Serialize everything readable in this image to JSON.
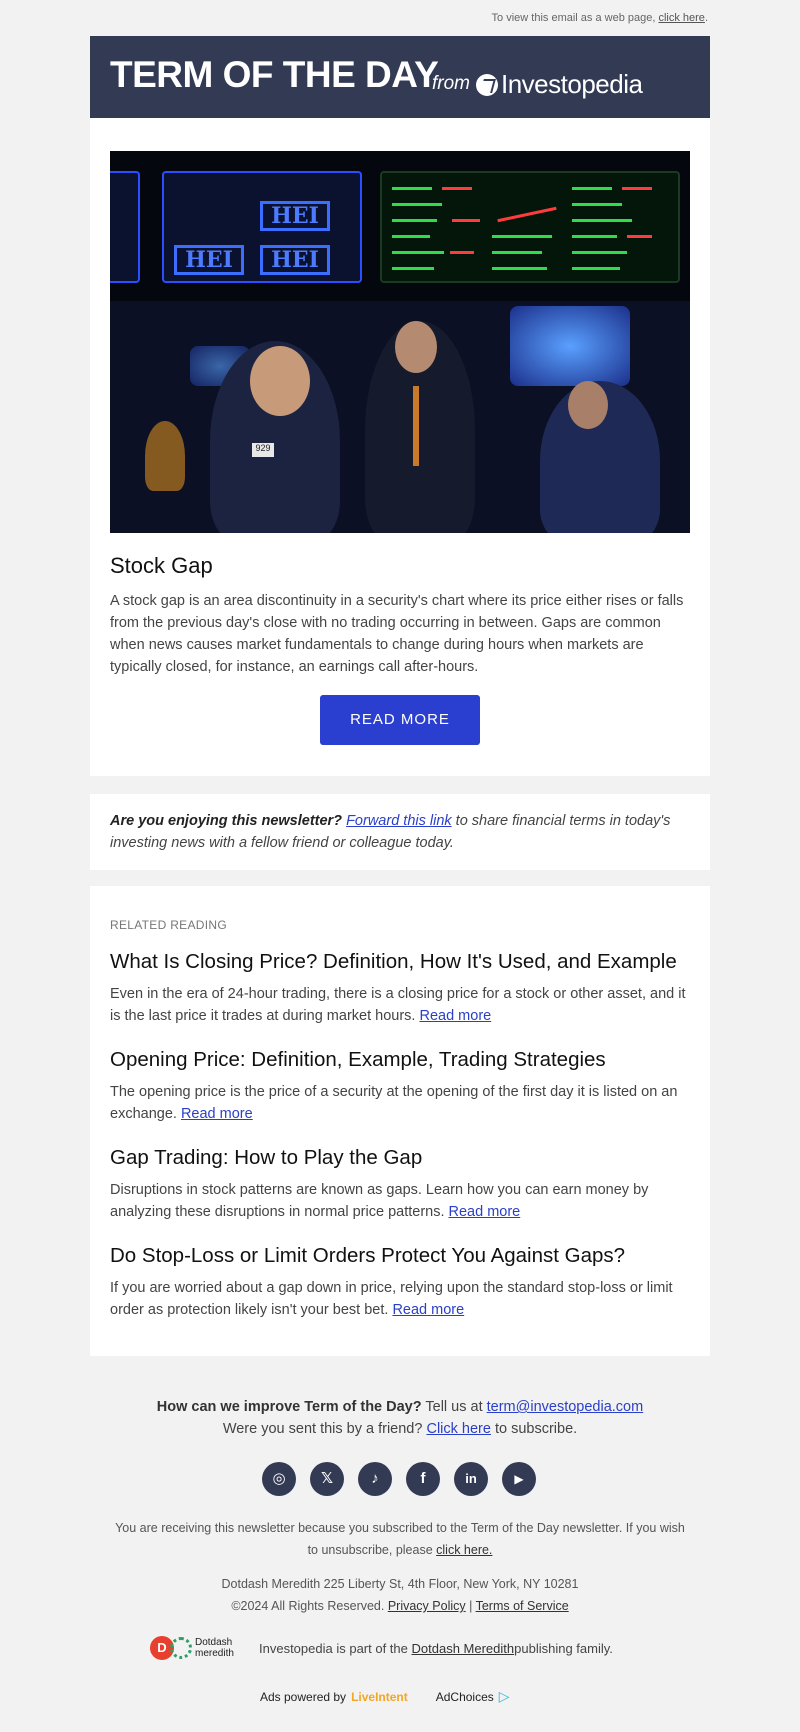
{
  "topline": {
    "text": "To view this email as a web page, ",
    "link": "click here",
    "end": "."
  },
  "header": {
    "title": "TERM OF THE DAY",
    "from": "from",
    "brand": "Investopedia"
  },
  "hero": {
    "board_labels": [
      "HEI",
      "HEI",
      "HEI"
    ],
    "badge": "929"
  },
  "term": {
    "title": "Stock Gap",
    "description": "A stock gap is an area discontinuity in a security's chart where its price either rises or falls from the previous day's close with no trading occurring in between. Gaps are common when news causes market fundamentals to change during hours when markets are typically closed, for instance, an earnings call after-hours.",
    "button": "READ MORE"
  },
  "share": {
    "bold": "Are you enjoying this newsletter?",
    "link": "Forward this link",
    "rest": " to share financial terms in today's investing news with a fellow friend or colleague today."
  },
  "related": {
    "label": "RELATED READING",
    "read_more": "Read more",
    "articles": [
      {
        "title": "What Is Closing Price? Definition, How It's Used, and Example",
        "summary": "Even in the era of 24-hour trading, there is a closing price for a stock or other asset, and it is the last price it trades at during market hours."
      },
      {
        "title": "Opening Price: Definition, Example, Trading Strategies",
        "summary": "The opening price is the price of a security at the opening of the first day it is listed on an exchange."
      },
      {
        "title": "Gap Trading: How to Play the Gap",
        "summary": "Disruptions in stock patterns are known as gaps. Learn how you can earn money by analyzing these disruptions in normal price patterns."
      },
      {
        "title": "Do Stop-Loss or Limit Orders Protect You Against Gaps?",
        "summary": "If you are worried about a gap down in price, relying upon the standard stop-loss or limit order as protection likely isn't your best bet."
      }
    ]
  },
  "footer": {
    "q": "How can we improve Term of the Day?",
    "tell": " Tell us at ",
    "email": "term@investopedia.com",
    "friend": "Were you sent this by a friend? ",
    "click": "Click here",
    "subscribe": " to subscribe.",
    "social": [
      {
        "icon": "instagram-icon",
        "glyph": "◎"
      },
      {
        "icon": "x-icon",
        "glyph": "𝕏"
      },
      {
        "icon": "tiktok-icon",
        "glyph": "♪"
      },
      {
        "icon": "facebook-icon",
        "glyph": "f"
      },
      {
        "icon": "linkedin-icon",
        "glyph": "in"
      },
      {
        "icon": "youtube-icon",
        "glyph": "▶"
      }
    ],
    "unsub_text": "You are receiving this newsletter because you subscribed to the Term of the Day newsletter. If you wish to unsubscribe, please ",
    "unsub_link": "click here.",
    "address": "Dotdash Meredith 225 Liberty St, 4th Floor, New York, NY 10281",
    "rights": "©2024 All Rights Reserved. ",
    "privacy": "Privacy Policy",
    "sep": " | ",
    "terms": "Terms of Service",
    "ddm_logo": "Dotdash meredith",
    "ddm_logo_d": "D",
    "family_text": "Investopedia is part of the ",
    "family_link": "Dotdash Meredith",
    "family_end": " publishing family.",
    "ads_text": "Ads powered by",
    "liveintent": "LiveIntent",
    "adchoices": "AdChoices"
  },
  "colors": {
    "header_bg": "#333a54",
    "button": "#2a3fcf",
    "link": "#2a3fc9",
    "page_bg": "#f2f2f2"
  }
}
